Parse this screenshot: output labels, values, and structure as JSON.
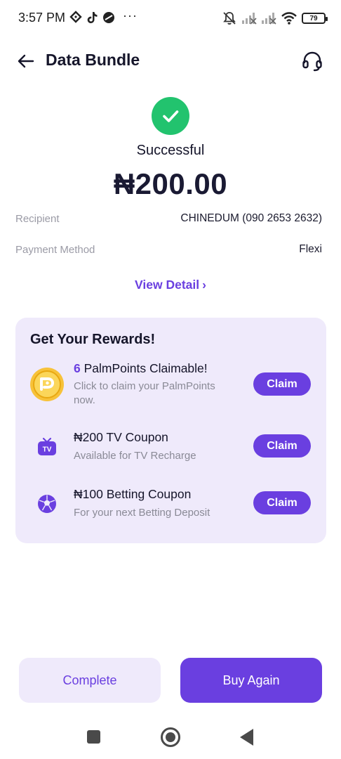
{
  "status_bar": {
    "time": "3:57 PM",
    "more": "···",
    "battery": "79"
  },
  "header": {
    "title": "Data Bundle"
  },
  "result": {
    "status": "Successful",
    "amount": "₦200.00"
  },
  "details": [
    {
      "label": "Recipient",
      "value": "CHINEDUM (090 2653 2632)"
    },
    {
      "label": "Payment Method",
      "value": "Flexi"
    }
  ],
  "view_detail": {
    "label": "View Detail",
    "chevron": "›"
  },
  "rewards": {
    "title": "Get Your Rewards!",
    "items": [
      {
        "icon": "palmpoints-coin-icon",
        "count": "6",
        "title": " PalmPoints Claimable!",
        "subtitle_line1": "Click to claim your PalmPoints",
        "subtitle_line2": "now.",
        "button": "Claim"
      },
      {
        "icon": "tv-icon",
        "title": "₦200 TV Coupon",
        "subtitle_line1": "Available for TV Recharge",
        "button": "Claim"
      },
      {
        "icon": "football-icon",
        "title": "₦100 Betting Coupon",
        "subtitle_line1": "For your next Betting Deposit",
        "button": "Claim"
      }
    ]
  },
  "actions": {
    "complete": "Complete",
    "buy_again": "Buy Again"
  },
  "colors": {
    "accent": "#6a3fe0",
    "success": "#22c36e",
    "card_bg": "#efeafb"
  }
}
